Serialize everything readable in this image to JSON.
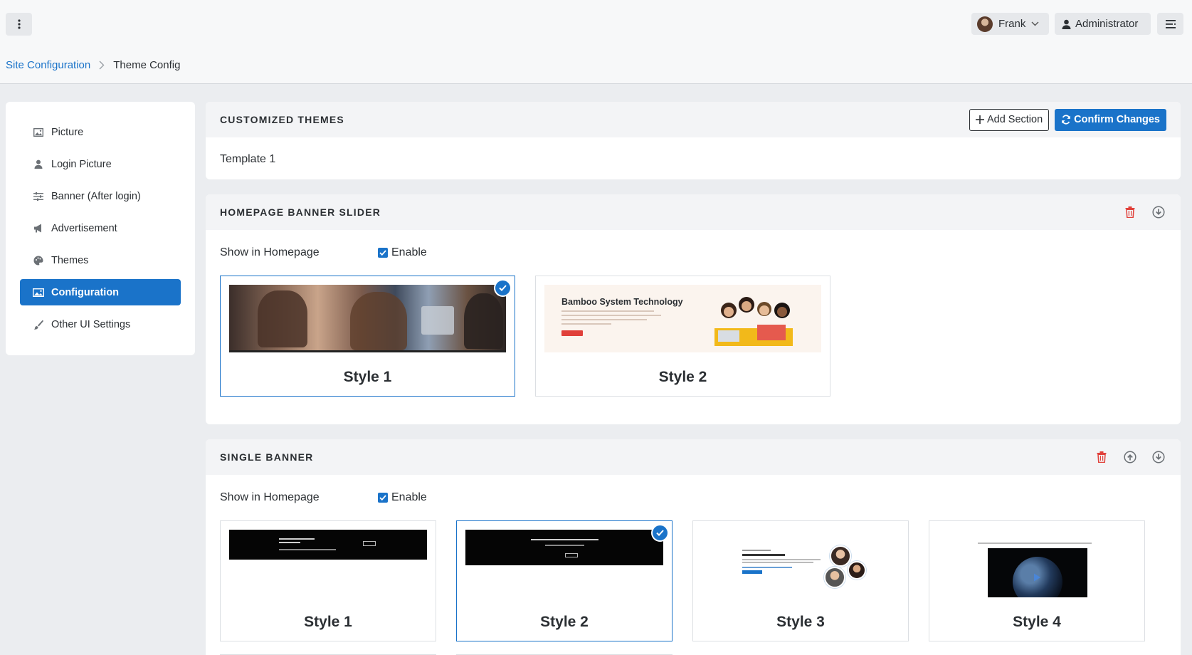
{
  "topbar": {
    "user_name": "Frank",
    "role": "Administrator",
    "colors": {
      "accent": "#1a73c9",
      "danger": "#e0403a"
    }
  },
  "breadcrumb": {
    "root": "Site Configuration",
    "current": "Theme Config"
  },
  "sidebar": {
    "items": [
      {
        "label": "Picture",
        "icon": "image-icon"
      },
      {
        "label": "Login Picture",
        "icon": "user-icon"
      },
      {
        "label": "Banner (After login)",
        "icon": "sliders-icon"
      },
      {
        "label": "Advertisement",
        "icon": "megaphone-icon"
      },
      {
        "label": "Themes",
        "icon": "palette-icon"
      },
      {
        "label": "Configuration",
        "icon": "image-icon",
        "active": true
      },
      {
        "label": "Other UI Settings",
        "icon": "brush-icon"
      }
    ]
  },
  "customized_themes": {
    "title": "CUSTOMIZED THEMES",
    "add_section_label": "Add Section",
    "confirm_label": "Confirm Changes",
    "template_name": "Template 1"
  },
  "homepage_banner_slider": {
    "title": "HOMEPAGE BANNER SLIDER",
    "show_label": "Show in Homepage",
    "enable_label": "Enable",
    "enabled": true,
    "styles": [
      {
        "label": "Style 1",
        "selected": true
      },
      {
        "label": "Style 2",
        "selected": false,
        "preview_title": "Bamboo System Technology"
      }
    ]
  },
  "single_banner": {
    "title": "SINGLE BANNER",
    "show_label": "Show in Homepage",
    "enable_label": "Enable",
    "enabled": true,
    "styles": [
      {
        "label": "Style 1",
        "selected": false
      },
      {
        "label": "Style 2",
        "selected": true
      },
      {
        "label": "Style 3",
        "selected": false
      },
      {
        "label": "Style 4",
        "selected": false
      }
    ]
  }
}
